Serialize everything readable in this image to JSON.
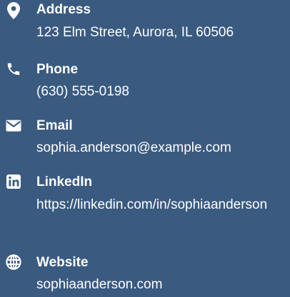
{
  "contact": {
    "items": [
      {
        "icon": "map-pin-icon",
        "label": "Address",
        "value": "123 Elm Street, Aurora, IL 60506"
      },
      {
        "icon": "phone-icon",
        "label": "Phone",
        "value": "(630) 555-0198"
      },
      {
        "icon": "envelope-icon",
        "label": "Email",
        "value": "sophia.anderson@example.com"
      },
      {
        "icon": "linkedin-icon",
        "label": "LinkedIn",
        "value": "https://linkedin.com/in/sophiaanderson"
      },
      {
        "icon": "globe-icon",
        "label": "Website",
        "value": "sophiaanderson.com"
      }
    ]
  },
  "colors": {
    "background": "#3a5a80",
    "text": "#ffffff"
  }
}
